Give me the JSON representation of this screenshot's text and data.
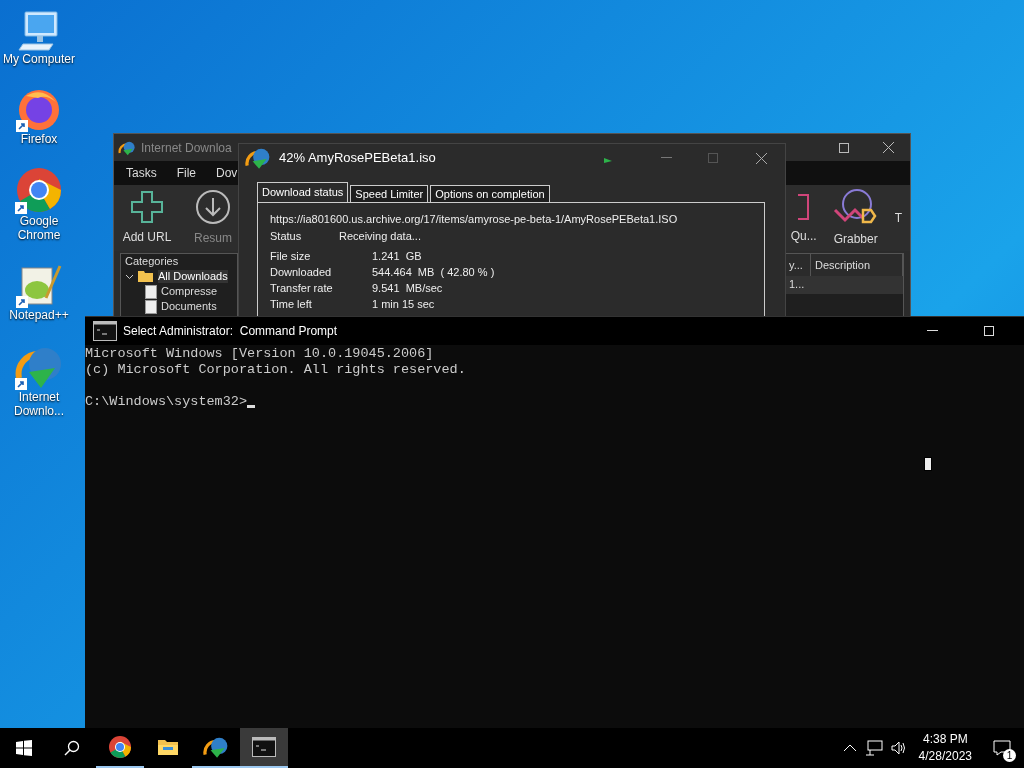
{
  "desktop_icons": [
    {
      "label": "My Computer",
      "kind": "computer",
      "shortcut": false
    },
    {
      "label": "Firefox",
      "kind": "firefox",
      "shortcut": true
    },
    {
      "label": "Google Chrome",
      "kind": "chrome",
      "shortcut": true
    },
    {
      "label": "Notepad++",
      "kind": "notepad",
      "shortcut": true
    },
    {
      "label": "Internet Downlo...",
      "kind": "idm",
      "shortcut": true
    }
  ],
  "idm_window": {
    "title": "Internet Downloa",
    "menu": [
      "Tasks",
      "File",
      "Dov"
    ],
    "toolbar_left": [
      {
        "label": "Add URL",
        "kind": "add",
        "disabled": false
      },
      {
        "label": "Resum",
        "kind": "resume",
        "disabled": true
      }
    ],
    "toolbar_right": [
      {
        "label": "Qu...",
        "kind": "queue"
      },
      {
        "label": "Grabber",
        "kind": "grabber"
      },
      {
        "label": "T",
        "kind": "none"
      }
    ],
    "categories": {
      "title": "Categories",
      "items": [
        {
          "label": "All Downloads",
          "expanded": true,
          "children": [
            {
              "label": "Compresse"
            },
            {
              "label": "Documents"
            }
          ]
        }
      ]
    },
    "table": {
      "columns": [
        "y...",
        "Description"
      ],
      "rows": [
        [
          "1..."
        ]
      ]
    }
  },
  "download_dialog": {
    "title": "42% AmyRosePEBeta1.iso",
    "tabs": [
      {
        "label": "Download status",
        "selected": true
      },
      {
        "label": "Speed Limiter",
        "selected": false
      },
      {
        "label": "Options on completion",
        "selected": false
      }
    ],
    "url": "https://ia801600.us.archive.org/17/items/amyrose-pe-beta-1/AmyRosePEBeta1.ISO",
    "status": {
      "label": "Status",
      "value": "Receiving data..."
    },
    "fields": [
      {
        "label": "File size",
        "value": "1.241  GB"
      },
      {
        "label": "Downloaded",
        "value": "544.464  MB  ( 42.80 % )"
      },
      {
        "label": "Transfer rate",
        "value": "9.541  MB/sec"
      },
      {
        "label": "Time left",
        "value": "1 min 15 sec"
      }
    ]
  },
  "cmd_window": {
    "title": "Select Administrator:  Command Prompt",
    "lines": [
      "Microsoft Windows [Version 10.0.19045.2006]",
      "(c) Microsoft Corporation. All rights reserved."
    ],
    "prompt": "C:\\Windows\\system32>"
  },
  "taskbar": {
    "apps": [
      {
        "kind": "chrome",
        "running": true,
        "selected": false
      },
      {
        "kind": "explorer",
        "running": false,
        "selected": false
      },
      {
        "kind": "idm",
        "running": true,
        "selected": false
      },
      {
        "kind": "cmd",
        "running": true,
        "selected": true
      }
    ],
    "time": "4:38 PM",
    "date": "4/28/2023",
    "notifications": "1"
  }
}
